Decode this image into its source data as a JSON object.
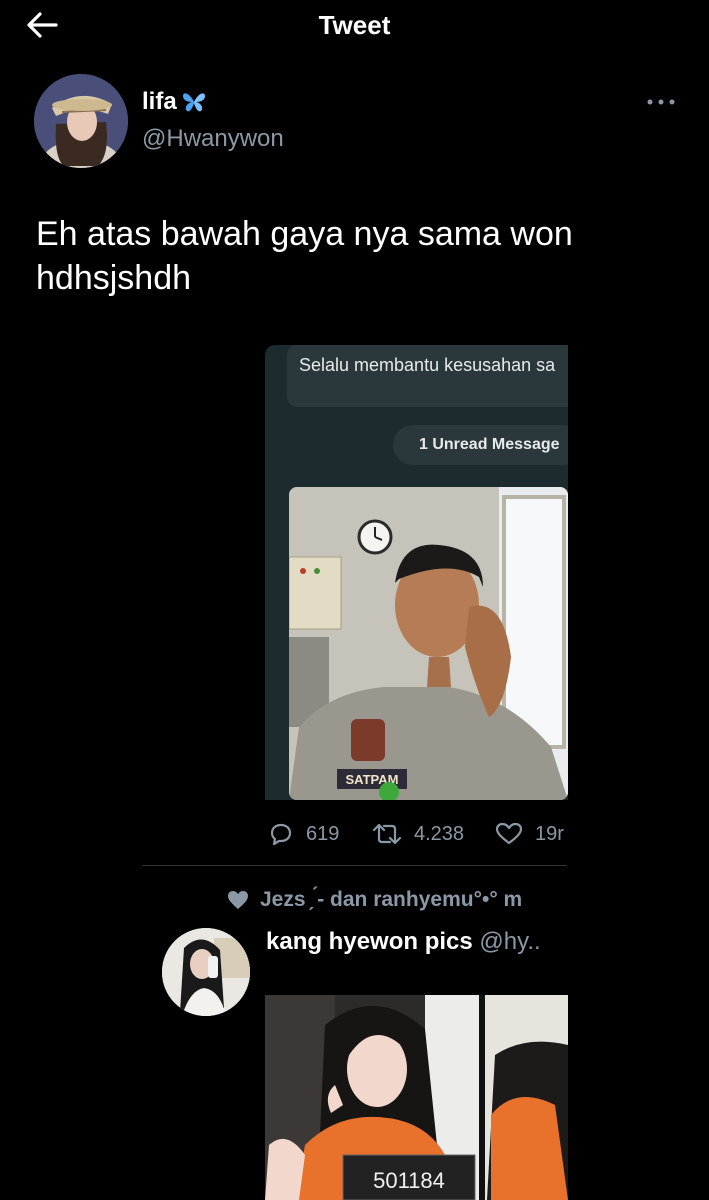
{
  "header": {
    "title": "Tweet"
  },
  "author": {
    "name": "lifa",
    "handle": "@Hwanywon"
  },
  "tweet": {
    "text": "Eh atas bawah gaya nya sama won hdhsjshdh"
  },
  "chat": {
    "message_preview": "Selalu membantu kesusahan sa",
    "unread_label": "1 Unread Message",
    "badge_text": "SATPAM"
  },
  "actions": {
    "replies": "619",
    "retweets": "4.238",
    "likes": "19r"
  },
  "reply": {
    "liked_by": "Jezs ̗ ́- dan ranhyemu°•° m",
    "name": "kang hyewon pics",
    "handle": "@hy.."
  },
  "reply_photo": {
    "placard": "501184"
  },
  "colors": {
    "background": "#000000",
    "text": "#e7e9ea",
    "secondary": "#8b98a5",
    "butterfly": "#4fa3f7"
  }
}
